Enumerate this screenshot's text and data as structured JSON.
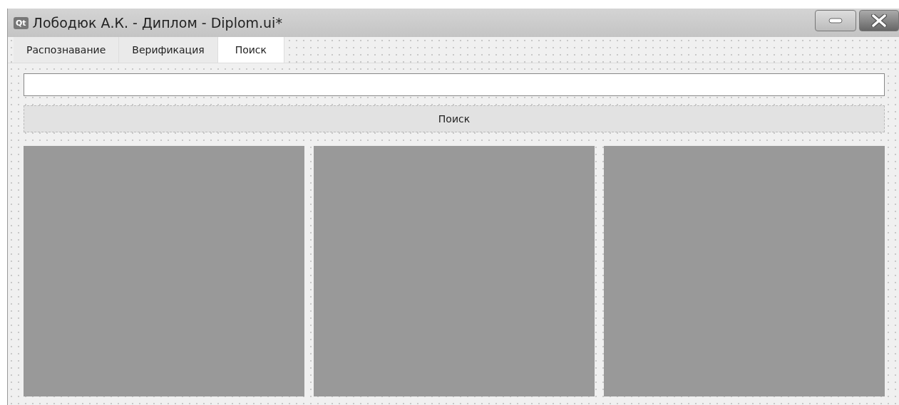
{
  "window": {
    "title": "Лободюк А.К. - Диплом - Diplom.ui*",
    "app_badge": "Qt"
  },
  "tabs": [
    {
      "label": "Распознавание",
      "selected": false
    },
    {
      "label": "Верификация",
      "selected": false
    },
    {
      "label": "Поиск",
      "selected": true
    }
  ],
  "search_button": {
    "label": "Поиск"
  },
  "panels": [
    {
      "kind": "empty"
    },
    {
      "kind": "empty"
    },
    {
      "kind": "empty"
    }
  ]
}
